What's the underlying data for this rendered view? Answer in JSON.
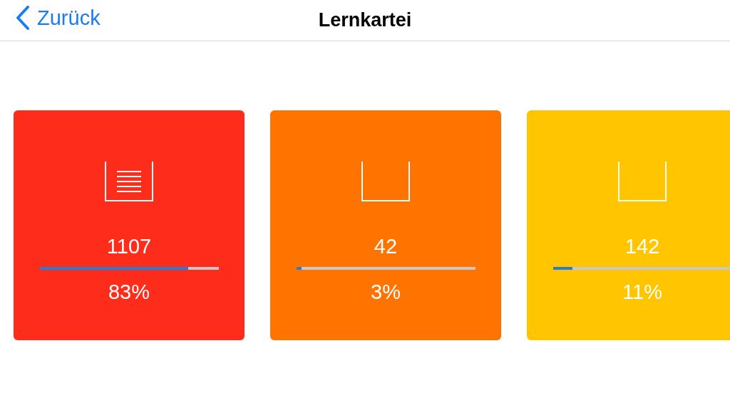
{
  "nav": {
    "back_label": "Zurück",
    "title": "Lernkartei"
  },
  "boxes": [
    {
      "filled": true,
      "color": "#fe2c1a",
      "count": "1107",
      "level": 0.83,
      "percent": "83%"
    },
    {
      "filled": false,
      "color": "#ff7300",
      "count": "42",
      "level": 0.03,
      "percent": "3%"
    },
    {
      "filled": false,
      "color": "#ffc600",
      "count": "142",
      "level": 0.11,
      "percent": "11%"
    }
  ]
}
